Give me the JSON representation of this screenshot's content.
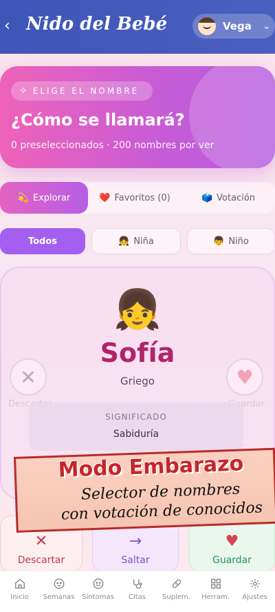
{
  "header": {
    "title": "Nido del Bebé",
    "user_name": "Vega"
  },
  "hero": {
    "badge": "ELIGE EL NOMBRE",
    "title": "¿Cómo se llamará?",
    "subtitle": "0 preseleccionados · 200 nombres por ver"
  },
  "tabs": [
    {
      "emoji": "💫",
      "label": "Explorar"
    },
    {
      "emoji": "❤️",
      "label": "Favoritos (0)"
    },
    {
      "emoji": "🗳️",
      "label": "Votación"
    }
  ],
  "filters": [
    {
      "emoji": "",
      "label": "Todos"
    },
    {
      "emoji": "👧",
      "label": "Niña"
    },
    {
      "emoji": "👦",
      "label": "Niño"
    }
  ],
  "card": {
    "emoji": "👧",
    "name": "Sofía",
    "origin": "Griego",
    "discard_label": "Descartar",
    "save_label": "Guardar",
    "meaning_label": "SIGNIFICADO",
    "meaning_value": "Sabiduría"
  },
  "promo": {
    "title": "Modo Embarazo",
    "line1": "Selector de nombres",
    "line2": "con votación de conocidos"
  },
  "actions": [
    {
      "label": "Descartar"
    },
    {
      "label": "Saltar"
    },
    {
      "label": "Guardar"
    }
  ],
  "bottom_nav": [
    {
      "label": "Inicio",
      "icon": "home-icon"
    },
    {
      "label": "Semanas",
      "icon": "baby-face-icon"
    },
    {
      "label": "Síntomas",
      "icon": "smile-icon"
    },
    {
      "label": "Citas",
      "icon": "stethoscope-icon"
    },
    {
      "label": "Suplem.",
      "icon": "pill-icon"
    },
    {
      "label": "Herram.",
      "icon": "grid-icon"
    },
    {
      "label": "Ajustes",
      "icon": "gear-icon"
    }
  ]
}
